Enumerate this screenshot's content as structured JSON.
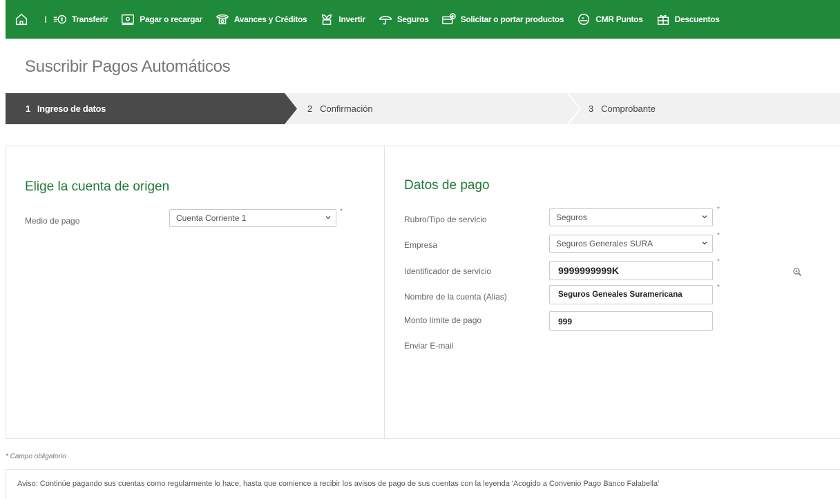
{
  "nav": {
    "items": [
      {
        "label": "Transferir",
        "icon": "money-transfer-icon"
      },
      {
        "label": "Pagar o recargar",
        "icon": "wallet-icon"
      },
      {
        "label": "Avances y Créditos",
        "icon": "phone-credit-icon"
      },
      {
        "label": "Invertir",
        "icon": "plant-icon"
      },
      {
        "label": "Seguros",
        "icon": "umbrella-icon"
      },
      {
        "label": "Solicitar o portar productos",
        "icon": "card-plus-icon"
      },
      {
        "label": "CMR Puntos",
        "icon": "cmr-icon"
      },
      {
        "label": "Descuentos",
        "icon": "gift-icon"
      }
    ],
    "separator": "I"
  },
  "page": {
    "title": "Suscribir Pagos Automáticos"
  },
  "stepper": {
    "steps": [
      {
        "number": "1",
        "label": "Ingreso de datos",
        "active": true
      },
      {
        "number": "2",
        "label": "Confirmación",
        "active": false
      },
      {
        "number": "3",
        "label": "Comprobante",
        "active": false
      }
    ]
  },
  "origin": {
    "title": "Elige la cuenta de origen",
    "medio_label": "Medio de pago",
    "medio_value": "Cuenta Corriente 1"
  },
  "payment": {
    "title": "Datos de pago",
    "rubro_label": "Rubro/Tipo de servicio",
    "rubro_value": "Seguros",
    "empresa_label": "Empresa",
    "empresa_value": "Seguros Generales SURA",
    "identificador_label": "Identificador de servicio",
    "identificador_value": "9999999999K",
    "alias_label": "Nombre de la cuenta (Alias)",
    "alias_value": "Seguros Geneales Suramericana",
    "monto_label": "Monto límite de pago",
    "monto_value": "999",
    "email_label": "Enviar E-mail"
  },
  "required_mark": "*",
  "footer": {
    "mandatory_note": "* Campo obligatorio",
    "notice": "Aviso: Continúe pagando sus cuentas como regularmente lo hace, hasta que comience a recibir los avisos de pago de sus cuentas con la leyenda 'Acogido a Convenio Pago Banco Falabella'"
  },
  "colors": {
    "brand_green": "#1f8a3a",
    "title_green": "#1f7a35",
    "active_step": "#4a4a4a",
    "inactive_step": "#f1f1f1"
  }
}
